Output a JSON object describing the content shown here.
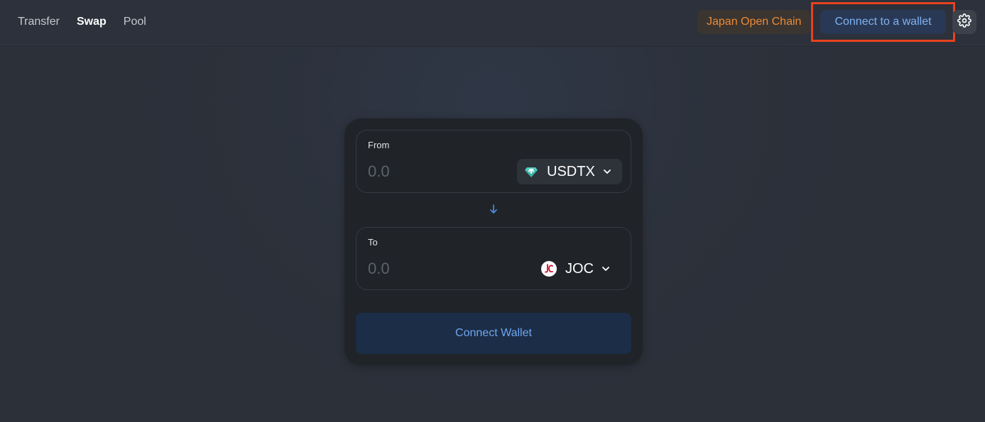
{
  "nav": {
    "items": [
      {
        "label": "Transfer",
        "active": false
      },
      {
        "label": "Swap",
        "active": true
      },
      {
        "label": "Pool",
        "active": false
      }
    ]
  },
  "header": {
    "network_label": "Japan Open Chain",
    "wallet_button_label": "Connect to a wallet",
    "settings_icon": "gear-icon"
  },
  "swap": {
    "from": {
      "label": "From",
      "placeholder": "0.0",
      "token": {
        "symbol": "USDTX",
        "icon": "usdtx-token-icon"
      }
    },
    "to": {
      "label": "To",
      "placeholder": "0.0",
      "token": {
        "symbol": "JOC",
        "icon": "joc-token-icon"
      }
    },
    "direction_icon": "arrow-down-icon",
    "action_button_label": "Connect Wallet"
  },
  "colors": {
    "accent_blue": "#7fb2f0",
    "network_orange": "#ed8936",
    "highlight_red": "#e8421e",
    "card_bg": "#202328"
  }
}
